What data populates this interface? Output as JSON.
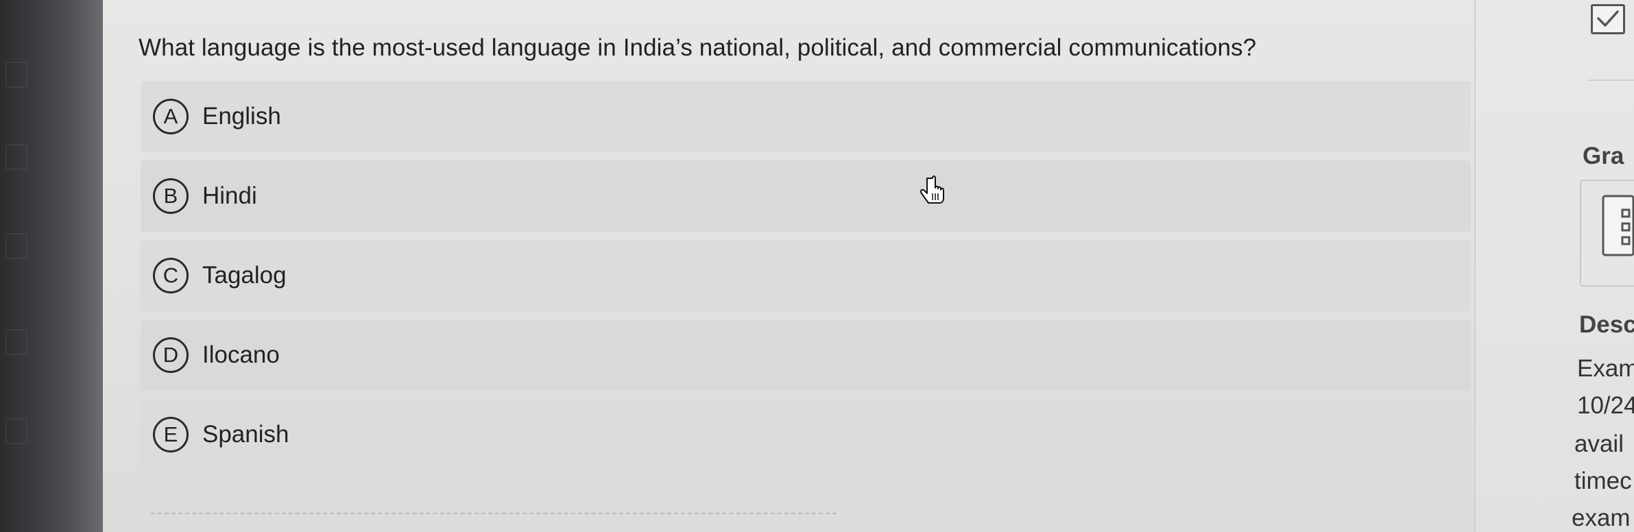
{
  "question": {
    "text": "What language is the most-used language in India’s national, political, and commercial communications?"
  },
  "options": [
    {
      "letter": "A",
      "label": "English"
    },
    {
      "letter": "B",
      "label": "Hindi"
    },
    {
      "letter": "C",
      "label": "Tagalog"
    },
    {
      "letter": "D",
      "label": "Ilocano"
    },
    {
      "letter": "E",
      "label": "Spanish"
    }
  ],
  "right_panel": {
    "grade_heading": "Gra",
    "description_heading": "Desc",
    "description_lines": [
      "Exam",
      "10/24",
      "avail",
      "timec",
      "exam"
    ]
  },
  "icons": {
    "checkbox": "checkmark-icon",
    "cursor": "hand-pointer-icon",
    "document": "document-icon"
  },
  "colors": {
    "background": "#e2e2e0",
    "text": "#222222",
    "badge_border": "#2a2a2a"
  }
}
